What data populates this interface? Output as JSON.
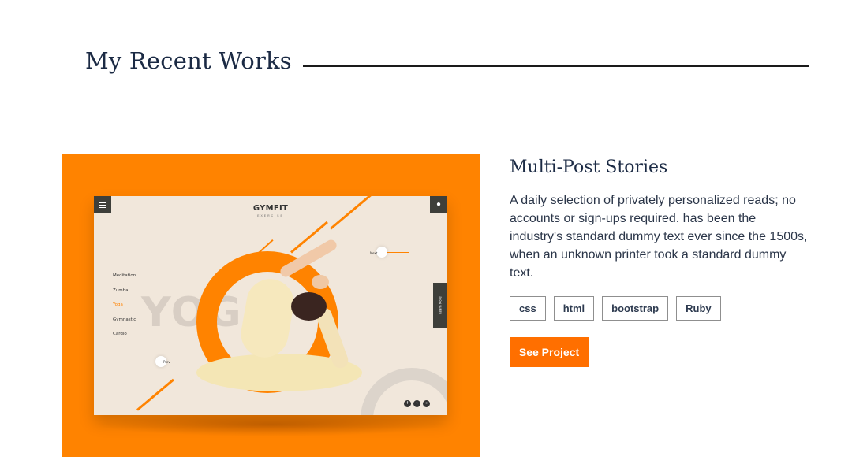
{
  "section": {
    "title": "My Recent Works"
  },
  "project": {
    "title": "Multi-Post Stories",
    "description": "A daily selection of privately personalized reads; no accounts or sign-ups required. has been the industry's standard dummy text ever since the 1500s, when an unknown printer took a standard dummy text.",
    "tags": [
      "css",
      "html",
      "bootstrap",
      "Ruby"
    ],
    "cta_label": "See Project"
  },
  "mockup": {
    "logo": "GYMFIT",
    "logo_sub": "EXERCISE",
    "nav": [
      "Meditation",
      "Zumba",
      "Yoga",
      "Gymnastic",
      "Cardio"
    ],
    "active_nav": "Yoga",
    "background_word": "YOGA",
    "next_label": "Next",
    "prev_label": "Prev",
    "side_button": "Learn More",
    "social_icons": [
      "facebook-icon",
      "twitter-icon",
      "instagram-icon"
    ]
  },
  "colors": {
    "accent": "#ff8300",
    "button": "#ff6f00",
    "heading": "#1b2a44",
    "text": "#2a3548"
  }
}
